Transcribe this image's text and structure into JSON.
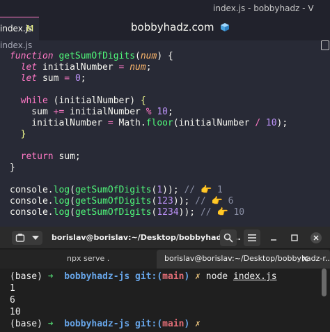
{
  "editor": {
    "window_title": "index.js - bobbyhadz - V",
    "tab": {
      "filename": "index.js",
      "modified_marker": "M"
    },
    "site_banner": "bobbyhadz.com",
    "breadcrumb": "index.js",
    "code": [
      [
        [
          "k",
          "function"
        ],
        [
          "t",
          " "
        ],
        [
          "fn",
          "getSumOfDigits"
        ],
        [
          "t",
          "("
        ],
        [
          "pa",
          "num"
        ],
        [
          "t",
          ") {"
        ]
      ],
      [
        [
          "t",
          "  "
        ],
        [
          "k",
          "let"
        ],
        [
          "t",
          " initialNumber "
        ],
        [
          "op",
          "="
        ],
        [
          "t",
          " "
        ],
        [
          "pa",
          "num"
        ],
        [
          "t",
          ";"
        ]
      ],
      [
        [
          "t",
          "  "
        ],
        [
          "k",
          "let"
        ],
        [
          "t",
          " sum "
        ],
        [
          "op",
          "="
        ],
        [
          "t",
          " "
        ],
        [
          "nu",
          "0"
        ],
        [
          "t",
          ";"
        ]
      ],
      [
        [
          "t",
          ""
        ]
      ],
      [
        [
          "t",
          "  "
        ],
        [
          "kn",
          "while"
        ],
        [
          "t",
          " (initialNumber) "
        ],
        [
          "br",
          "{"
        ]
      ],
      [
        [
          "t",
          "    sum "
        ],
        [
          "op",
          "+="
        ],
        [
          "t",
          " initialNumber "
        ],
        [
          "op",
          "%"
        ],
        [
          "t",
          " "
        ],
        [
          "nu",
          "10"
        ],
        [
          "t",
          ";"
        ]
      ],
      [
        [
          "t",
          "    initialNumber "
        ],
        [
          "op",
          "="
        ],
        [
          "t",
          " Math."
        ],
        [
          "fn",
          "floor"
        ],
        [
          "t",
          "(initialNumber "
        ],
        [
          "op",
          "/"
        ],
        [
          "t",
          " "
        ],
        [
          "nu",
          "10"
        ],
        [
          "t",
          ");"
        ]
      ],
      [
        [
          "t",
          "  "
        ],
        [
          "br",
          "}"
        ]
      ],
      [
        [
          "t",
          ""
        ]
      ],
      [
        [
          "t",
          "  "
        ],
        [
          "kn",
          "return"
        ],
        [
          "t",
          " sum;"
        ]
      ],
      [
        [
          "t",
          "}"
        ]
      ],
      [
        [
          "t",
          ""
        ]
      ],
      [
        [
          "t",
          "console."
        ],
        [
          "pr",
          "log"
        ],
        [
          "t",
          "("
        ],
        [
          "fn",
          "getSumOfDigits"
        ],
        [
          "t",
          "("
        ],
        [
          "nu",
          "1"
        ],
        [
          "t",
          "));"
        ],
        [
          "cm",
          " // 👉 1"
        ]
      ],
      [
        [
          "t",
          "console."
        ],
        [
          "pr",
          "log"
        ],
        [
          "t",
          "("
        ],
        [
          "fn",
          "getSumOfDigits"
        ],
        [
          "t",
          "("
        ],
        [
          "nu",
          "123"
        ],
        [
          "t",
          "));"
        ],
        [
          "cm",
          " // 👉 6"
        ]
      ],
      [
        [
          "t",
          "console."
        ],
        [
          "pr",
          "log"
        ],
        [
          "t",
          "("
        ],
        [
          "fn",
          "getSumOfDigits"
        ],
        [
          "t",
          "("
        ],
        [
          "nu",
          "1234"
        ],
        [
          "t",
          "));"
        ],
        [
          "cm",
          " // 👉 10"
        ]
      ]
    ]
  },
  "terminal": {
    "title": "borislav@borislav:~/Desktop/bobbyhadz-r...",
    "tabs": [
      {
        "label": "npx serve ."
      },
      {
        "label": "borislav@borislav:~/Desktop/bobbyhadz-r..."
      }
    ],
    "lines": [
      [
        [
          "t",
          "(base) "
        ],
        [
          "t-arrow",
          "➜"
        ],
        [
          "t",
          "  "
        ],
        [
          "t-dir",
          "bobbyhadz-js"
        ],
        [
          "t",
          " "
        ],
        [
          "t-git",
          "git:("
        ],
        [
          "t-branch",
          "main"
        ],
        [
          "t-git",
          ")"
        ],
        [
          "t",
          " "
        ],
        [
          "t-x",
          "✗"
        ],
        [
          "t",
          " node "
        ],
        [
          "t-file",
          "index.js"
        ]
      ],
      [
        [
          "t",
          "1"
        ]
      ],
      [
        [
          "t",
          "6"
        ]
      ],
      [
        [
          "t",
          "10"
        ]
      ],
      [
        [
          "t",
          "(base) "
        ],
        [
          "t-arrow",
          "➜"
        ],
        [
          "t",
          "  "
        ],
        [
          "t-dir",
          "bobbyhadz-js"
        ],
        [
          "t",
          " "
        ],
        [
          "t-git",
          "git:("
        ],
        [
          "t-branch",
          "main"
        ],
        [
          "t-git",
          ")"
        ],
        [
          "t",
          " "
        ],
        [
          "t-x",
          "✗"
        ]
      ]
    ]
  },
  "icons": {
    "banner": "cube-icon",
    "split": "split-editor-icon",
    "new_tab": "new-tab-icon",
    "dropdown": "chevron-down-icon",
    "search": "search-icon",
    "menu": "hamburger-menu-icon",
    "minimize": "minimize-icon",
    "maximize": "maximize-icon",
    "close": "close-icon"
  },
  "colors": {
    "editor_bg": "#282a36",
    "keyword": "#ff79c6",
    "function": "#50fa7b",
    "param": "#ffb86c",
    "number": "#bd93f9",
    "comment": "#8b90a6",
    "terminal_bg": "#1f1f1f",
    "prompt_arrow": "#4ec96b",
    "prompt_dir": "#67a5e8",
    "prompt_branch": "#e06c75"
  }
}
